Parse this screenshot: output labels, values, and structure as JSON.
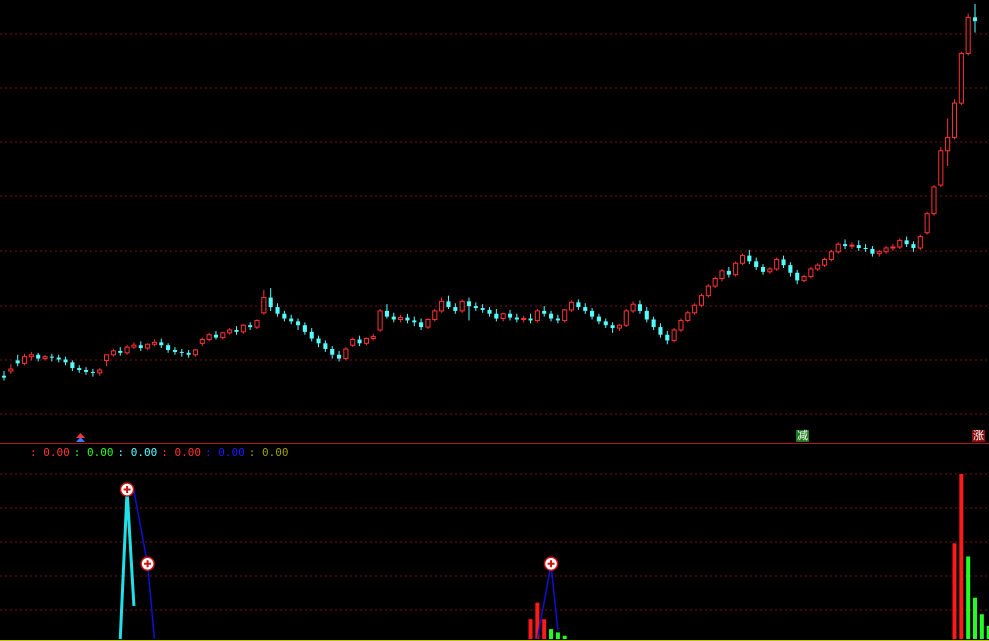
{
  "app": {
    "theme": "dark-trading-terminal"
  },
  "colors": {
    "background": "#000000",
    "up": "#ff3232",
    "down": "#54ffff",
    "grid": "#7a1010",
    "divider": "#b01818",
    "histogram_red": "#ff1a1a",
    "histogram_green": "#22ff22",
    "cyan_spike": "#20e0e8",
    "blue_line": "#1010d0",
    "bottom_axis": "#c8c800"
  },
  "main_chart": {
    "badges": {
      "reduce": "减",
      "rise": "涨"
    },
    "markers": [
      {
        "icon": "up-arrow-icon",
        "bar_index": 0
      }
    ]
  },
  "indicator": {
    "legend": [
      {
        "text": ": 0.00",
        "color": "#ff3232"
      },
      {
        "text": ": 0.00",
        "color": "#22ff22"
      },
      {
        "text": ": 0.00",
        "color": "#54ffff"
      },
      {
        "text": ": 0.00",
        "color": "#ff3232"
      },
      {
        "text": ": 0.00",
        "color": "#1a1aff"
      },
      {
        "text": ": 0.00",
        "color": "#a0a000"
      }
    ],
    "signal_icons": [
      "plus-circle-icon",
      "plus-circle-icon",
      "plus-circle-icon"
    ]
  },
  "chart_data": [
    {
      "type": "candlestick",
      "title": "",
      "grid": true,
      "candles": [
        [
          0.9,
          0.95,
          0.88,
          0.85
        ],
        [
          0.95,
          1.02,
          0.97,
          0.92
        ],
        [
          1.06,
          1.12,
          1.03,
          1.0
        ],
        [
          1.03,
          1.13,
          1.1,
          1.01
        ],
        [
          1.1,
          1.15,
          1.12,
          1.06
        ],
        [
          1.12,
          1.14,
          1.08,
          1.05
        ],
        [
          1.08,
          1.12,
          1.1,
          1.06
        ],
        [
          1.1,
          1.13,
          1.09,
          1.05
        ],
        [
          1.09,
          1.12,
          1.07,
          1.04
        ],
        [
          1.07,
          1.1,
          1.04,
          1.01
        ],
        [
          1.04,
          1.06,
          0.98,
          0.95
        ],
        [
          0.98,
          1.01,
          0.96,
          0.93
        ],
        [
          0.96,
          0.99,
          0.94,
          0.91
        ],
        [
          0.94,
          0.97,
          0.93,
          0.89
        ],
        [
          0.93,
          0.98,
          0.96,
          0.9
        ],
        [
          1.06,
          1.12,
          1.12,
          1.0
        ],
        [
          1.12,
          1.18,
          1.16,
          1.1
        ],
        [
          1.16,
          1.2,
          1.14,
          1.11
        ],
        [
          1.14,
          1.22,
          1.2,
          1.12
        ],
        [
          1.2,
          1.25,
          1.22,
          1.18
        ],
        [
          1.22,
          1.26,
          1.19,
          1.16
        ],
        [
          1.19,
          1.24,
          1.23,
          1.17
        ],
        [
          1.23,
          1.28,
          1.25,
          1.21
        ],
        [
          1.25,
          1.29,
          1.22,
          1.19
        ],
        [
          1.22,
          1.24,
          1.17,
          1.14
        ],
        [
          1.17,
          1.2,
          1.15,
          1.12
        ],
        [
          1.15,
          1.18,
          1.14,
          1.1
        ],
        [
          1.14,
          1.17,
          1.12,
          1.09
        ],
        [
          1.12,
          1.18,
          1.17,
          1.1
        ],
        [
          1.24,
          1.3,
          1.28,
          1.21
        ],
        [
          1.28,
          1.35,
          1.33,
          1.26
        ],
        [
          1.33,
          1.37,
          1.3,
          1.28
        ],
        [
          1.3,
          1.36,
          1.35,
          1.28
        ],
        [
          1.35,
          1.4,
          1.38,
          1.33
        ],
        [
          1.38,
          1.42,
          1.36,
          1.33
        ],
        [
          1.36,
          1.44,
          1.43,
          1.34
        ],
        [
          1.43,
          1.46,
          1.41,
          1.38
        ],
        [
          1.41,
          1.49,
          1.48,
          1.39
        ],
        [
          1.56,
          1.8,
          1.72,
          1.54
        ],
        [
          1.72,
          1.82,
          1.62,
          1.58
        ],
        [
          1.62,
          1.66,
          1.55,
          1.52
        ],
        [
          1.55,
          1.58,
          1.5,
          1.47
        ],
        [
          1.5,
          1.54,
          1.47,
          1.44
        ],
        [
          1.47,
          1.5,
          1.43,
          1.38
        ],
        [
          1.43,
          1.46,
          1.36,
          1.33
        ],
        [
          1.36,
          1.4,
          1.29,
          1.26
        ],
        [
          1.29,
          1.32,
          1.24,
          1.2
        ],
        [
          1.24,
          1.27,
          1.18,
          1.15
        ],
        [
          1.18,
          1.21,
          1.12,
          1.08
        ],
        [
          1.12,
          1.16,
          1.08,
          1.05
        ],
        [
          1.08,
          1.2,
          1.18,
          1.06
        ],
        [
          1.22,
          1.3,
          1.28,
          1.2
        ],
        [
          1.28,
          1.32,
          1.24,
          1.21
        ],
        [
          1.24,
          1.3,
          1.29,
          1.22
        ],
        [
          1.29,
          1.34,
          1.31,
          1.27
        ],
        [
          1.38,
          1.6,
          1.58,
          1.36
        ],
        [
          1.58,
          1.65,
          1.52,
          1.5
        ],
        [
          1.52,
          1.56,
          1.49,
          1.46
        ],
        [
          1.49,
          1.54,
          1.51,
          1.46
        ],
        [
          1.51,
          1.55,
          1.48,
          1.45
        ],
        [
          1.48,
          1.52,
          1.46,
          1.42
        ],
        [
          1.46,
          1.5,
          1.41,
          1.38
        ],
        [
          1.41,
          1.5,
          1.49,
          1.39
        ],
        [
          1.49,
          1.6,
          1.58,
          1.47
        ],
        [
          1.58,
          1.72,
          1.68,
          1.56
        ],
        [
          1.68,
          1.74,
          1.62,
          1.6
        ],
        [
          1.62,
          1.66,
          1.58,
          1.55
        ],
        [
          1.58,
          1.7,
          1.68,
          1.56
        ],
        [
          1.68,
          1.72,
          1.63,
          1.48
        ],
        [
          1.63,
          1.67,
          1.61,
          1.58
        ],
        [
          1.61,
          1.65,
          1.59,
          1.56
        ],
        [
          1.59,
          1.62,
          1.55,
          1.52
        ],
        [
          1.55,
          1.6,
          1.5,
          1.47
        ],
        [
          1.5,
          1.56,
          1.55,
          1.47
        ],
        [
          1.55,
          1.59,
          1.51,
          1.48
        ],
        [
          1.51,
          1.55,
          1.49,
          1.46
        ],
        [
          1.49,
          1.53,
          1.5,
          1.46
        ],
        [
          1.5,
          1.55,
          1.48,
          1.45
        ],
        [
          1.48,
          1.6,
          1.58,
          1.46
        ],
        [
          1.58,
          1.63,
          1.55,
          1.52
        ],
        [
          1.55,
          1.58,
          1.5,
          1.47
        ],
        [
          1.5,
          1.54,
          1.48,
          1.45
        ],
        [
          1.48,
          1.6,
          1.59,
          1.46
        ],
        [
          1.59,
          1.69,
          1.67,
          1.57
        ],
        [
          1.67,
          1.7,
          1.62,
          1.59
        ],
        [
          1.62,
          1.66,
          1.58,
          1.55
        ],
        [
          1.58,
          1.61,
          1.52,
          1.49
        ],
        [
          1.52,
          1.55,
          1.47,
          1.44
        ],
        [
          1.47,
          1.5,
          1.43,
          1.4
        ],
        [
          1.43,
          1.46,
          1.4,
          1.35
        ],
        [
          1.4,
          1.44,
          1.43,
          1.37
        ],
        [
          1.43,
          1.6,
          1.58,
          1.41
        ],
        [
          1.58,
          1.68,
          1.65,
          1.56
        ],
        [
          1.65,
          1.69,
          1.58,
          1.55
        ],
        [
          1.58,
          1.62,
          1.49,
          1.46
        ],
        [
          1.49,
          1.52,
          1.41,
          1.38
        ],
        [
          1.41,
          1.45,
          1.33,
          1.3
        ],
        [
          1.33,
          1.37,
          1.27,
          1.23
        ],
        [
          1.27,
          1.4,
          1.38,
          1.25
        ],
        [
          1.38,
          1.5,
          1.48,
          1.36
        ],
        [
          1.48,
          1.58,
          1.56,
          1.46
        ],
        [
          1.56,
          1.66,
          1.64,
          1.54
        ],
        [
          1.64,
          1.76,
          1.74,
          1.62
        ],
        [
          1.74,
          1.86,
          1.84,
          1.72
        ],
        [
          1.84,
          1.94,
          1.92,
          1.82
        ],
        [
          1.92,
          2.02,
          2.0,
          1.89
        ],
        [
          2.0,
          2.04,
          1.96,
          1.93
        ],
        [
          1.96,
          2.1,
          2.08,
          1.94
        ],
        [
          2.08,
          2.18,
          2.16,
          2.06
        ],
        [
          2.16,
          2.22,
          2.1,
          2.07
        ],
        [
          2.1,
          2.14,
          2.04,
          2.01
        ],
        [
          2.04,
          2.07,
          1.99,
          1.96
        ],
        [
          1.99,
          2.04,
          2.02,
          1.97
        ],
        [
          2.02,
          2.14,
          2.12,
          2.0
        ],
        [
          2.12,
          2.16,
          2.06,
          2.03
        ],
        [
          2.06,
          2.09,
          1.98,
          1.94
        ],
        [
          1.98,
          2.01,
          1.9,
          1.86
        ],
        [
          1.9,
          1.96,
          1.94,
          1.88
        ],
        [
          1.94,
          2.04,
          2.02,
          1.92
        ],
        [
          2.02,
          2.08,
          2.06,
          2.0
        ],
        [
          2.06,
          2.14,
          2.12,
          2.04
        ],
        [
          2.12,
          2.22,
          2.2,
          2.1
        ],
        [
          2.2,
          2.3,
          2.28,
          2.18
        ],
        [
          2.28,
          2.33,
          2.26,
          2.23
        ],
        [
          2.26,
          2.3,
          2.27,
          2.23
        ],
        [
          2.27,
          2.32,
          2.24,
          2.21
        ],
        [
          2.24,
          2.28,
          2.23,
          2.2
        ],
        [
          2.23,
          2.26,
          2.18,
          2.15
        ],
        [
          2.18,
          2.22,
          2.2,
          2.15
        ],
        [
          2.2,
          2.26,
          2.24,
          2.18
        ],
        [
          2.24,
          2.28,
          2.25,
          2.21
        ],
        [
          2.25,
          2.34,
          2.32,
          2.23
        ],
        [
          2.32,
          2.36,
          2.28,
          2.25
        ],
        [
          2.28,
          2.31,
          2.24,
          2.2
        ],
        [
          2.24,
          2.38,
          2.36,
          2.22
        ],
        [
          2.4,
          2.62,
          2.6,
          2.38
        ],
        [
          2.6,
          2.9,
          2.88,
          2.58
        ],
        [
          2.9,
          3.3,
          3.26,
          2.88
        ],
        [
          3.26,
          3.6,
          3.4,
          3.1
        ],
        [
          3.4,
          3.8,
          3.76,
          3.38
        ],
        [
          3.76,
          4.3,
          4.28,
          3.74
        ],
        [
          4.28,
          4.7,
          4.66,
          4.26
        ],
        [
          4.66,
          4.8,
          4.62,
          4.5
        ]
      ],
      "ylim": [
        0.75,
        4.8
      ]
    },
    {
      "type": "bar",
      "title": "",
      "grid": true,
      "series": [
        {
          "values": [
            0,
            0,
            0,
            0,
            0,
            0,
            0,
            0,
            0,
            0,
            0,
            0,
            0,
            0,
            0,
            0,
            0,
            0,
            0,
            0,
            0,
            0,
            0,
            0,
            0,
            0,
            0,
            0,
            0,
            0,
            0,
            0,
            0,
            0,
            0,
            0,
            0,
            0,
            0,
            0,
            0,
            0,
            0,
            0,
            0,
            0,
            0,
            0,
            0,
            0,
            0,
            0,
            0,
            0,
            0,
            0,
            0,
            0,
            0,
            0,
            0,
            0,
            0,
            0,
            0,
            0,
            0,
            0,
            0,
            0,
            0,
            0,
            0,
            0,
            0,
            0,
            0,
            0,
            0,
            0,
            0,
            0,
            0,
            0,
            0,
            0,
            0,
            0,
            0,
            0,
            0,
            0,
            0,
            0,
            0,
            0,
            0,
            0,
            0,
            0,
            0,
            0,
            0,
            0,
            0,
            0,
            0,
            0,
            0,
            0,
            0,
            0,
            0,
            0,
            0,
            0,
            0,
            0,
            0,
            0,
            0,
            0,
            0,
            0,
            0,
            0,
            0,
            0,
            0,
            0,
            0,
            0,
            0,
            0,
            0,
            0,
            0,
            0,
            0,
            0,
            0,
            0,
            0,
            0,
            0,
            0,
            0,
            0,
            0,
            0
          ]
        }
      ],
      "red_bars": [
        [
          77,
          0.12
        ],
        [
          78,
          0.22
        ],
        [
          79,
          0.12
        ],
        [
          139,
          0.58
        ],
        [
          140,
          1.0
        ],
        [
          150,
          0.24
        ],
        [
          151,
          0.4
        ]
      ],
      "green_bars": [
        [
          80,
          0.06
        ],
        [
          81,
          0.04
        ],
        [
          82,
          0.02
        ],
        [
          141,
          0.5
        ],
        [
          142,
          0.25
        ],
        [
          143,
          0.15
        ],
        [
          144,
          0.08
        ],
        [
          145,
          0.04
        ],
        [
          146,
          0.02
        ],
        [
          152,
          0.2
        ],
        [
          153,
          0.1
        ],
        [
          154,
          0.06
        ],
        [
          155,
          0.03
        ],
        [
          156,
          0.02
        ]
      ],
      "cyan_spike": [
        [
          17,
          0.0
        ],
        [
          18,
          0.9
        ],
        [
          19,
          0.2
        ]
      ],
      "blue_lines": [
        [
          [
            19,
            0.9
          ],
          [
            21,
            0.45
          ],
          [
            22,
            0.0
          ]
        ],
        [
          [
            78,
            0.0
          ],
          [
            80,
            0.45
          ],
          [
            81,
            0.05
          ]
        ]
      ],
      "ylim": [
        0,
        1.0
      ]
    }
  ]
}
